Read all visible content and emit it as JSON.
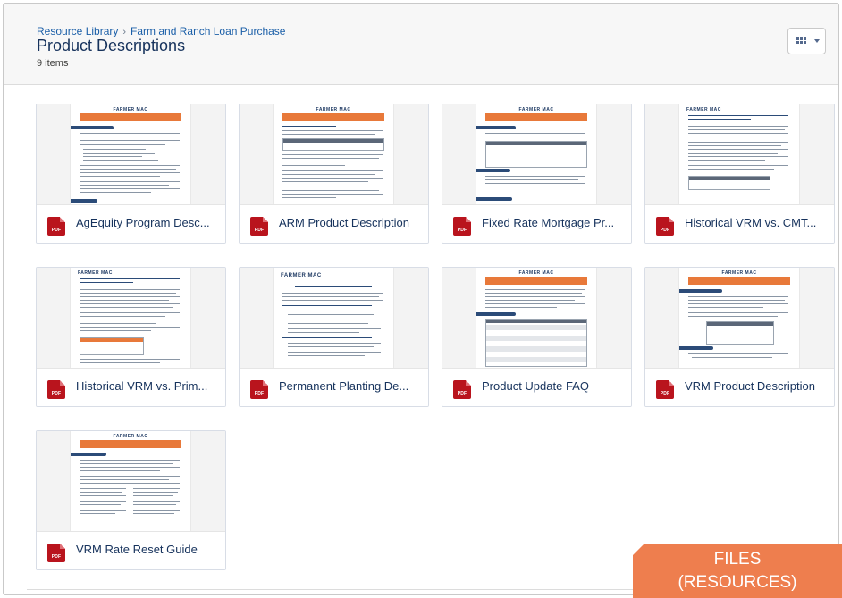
{
  "header": {
    "breadcrumb": [
      "Resource Library",
      "Farm and Ranch Loan Purchase"
    ],
    "title": "Product Descriptions",
    "count": "9 items",
    "view_button_icon": "grid-view-icon"
  },
  "brand_text": "FARMER MAC",
  "files": [
    {
      "name": "AgEquity Program Desc...",
      "type_label": "PDF",
      "icon": "pdf-file-icon"
    },
    {
      "name": "ARM Product Description",
      "type_label": "PDF",
      "icon": "pdf-file-icon"
    },
    {
      "name": "Fixed Rate Mortgage Pr...",
      "type_label": "PDF",
      "icon": "pdf-file-icon"
    },
    {
      "name": "Historical VRM vs. CMT...",
      "type_label": "PDF",
      "icon": "pdf-file-icon"
    },
    {
      "name": "Historical VRM vs. Prim...",
      "type_label": "PDF",
      "icon": "pdf-file-icon"
    },
    {
      "name": "Permanent Planting De...",
      "type_label": "PDF",
      "icon": "pdf-file-icon"
    },
    {
      "name": "Product Update FAQ",
      "type_label": "PDF",
      "icon": "pdf-file-icon"
    },
    {
      "name": "VRM Product Description",
      "type_label": "PDF",
      "icon": "pdf-file-icon"
    },
    {
      "name": "VRM Rate Reset Guide",
      "type_label": "PDF",
      "icon": "pdf-file-icon"
    }
  ],
  "badge": {
    "line1": "FILES",
    "line2": "(RESOURCES)"
  },
  "colors": {
    "accent": "#ee7e4e",
    "pdf": "#b9141d",
    "link": "#1b5fa8",
    "title": "#16325c"
  }
}
